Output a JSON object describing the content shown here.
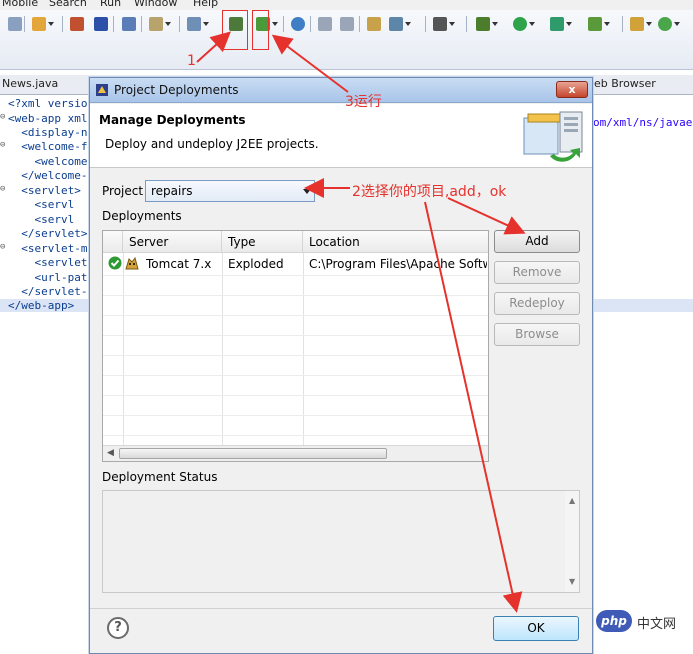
{
  "menu": [
    "Mobile",
    "Search",
    "Run",
    "Window",
    "Help"
  ],
  "editor": {
    "tab_news": "News.java",
    "tab_browser": "eb Browser",
    "namespace_text": "om/xml/ns/javae",
    "lines": [
      "<?xml versio",
      "<web-app xml",
      "  <display-n",
      "  <welcome-f",
      "    <welcome",
      "  </welcome-",
      "  <servlet>",
      "    <servl",
      "    <servl",
      "  </servlet>",
      "  <servlet-m",
      "    <servlet",
      "    <url-pat",
      "  </servlet-",
      "</web-app>"
    ]
  },
  "dialog": {
    "title": "Project Deployments",
    "close_label": "x",
    "header_title": "Manage Deployments",
    "header_desc": "Deploy and undeploy J2EE projects.",
    "project_label": "Project",
    "project_value": "repairs",
    "deployments_label": "Deployments",
    "columns": [
      "Server",
      "Type",
      "Location"
    ],
    "rows": [
      {
        "server": "Tomcat  7.x",
        "type": "Exploded",
        "location": "C:\\Program Files\\Apache Softwa"
      }
    ],
    "buttons": {
      "add": "Add",
      "remove": "Remove",
      "redeploy": "Redeploy",
      "browse": "Browse"
    },
    "status_label": "Deployment Status",
    "help_label": "?",
    "ok_label": "OK"
  },
  "annotations": {
    "a1": "1",
    "a3": "3运行",
    "a2": "2选择你的项目,add，ok",
    "color": "#e5322d"
  },
  "watermark": {
    "logo": "php",
    "text": "中文网"
  },
  "colors": {
    "title_bar": "#a9c5ea",
    "dialog_bg": "#f0f0f0",
    "close": "#c5462c",
    "annotation": "#e5322d"
  }
}
